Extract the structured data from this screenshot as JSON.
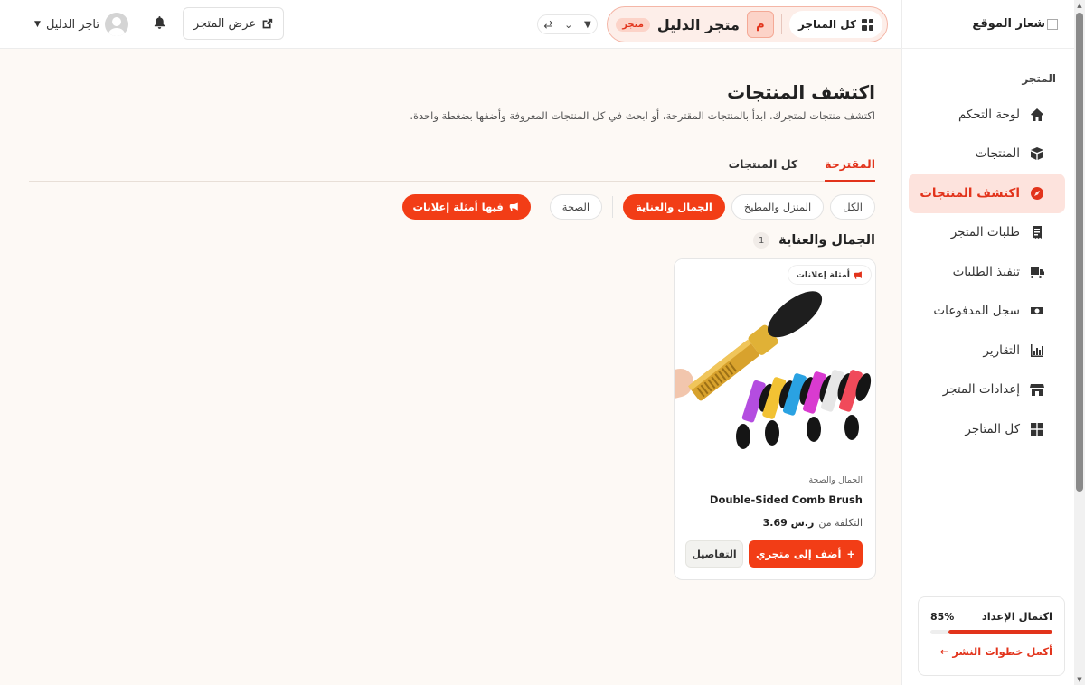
{
  "sidebar": {
    "logo_text": "شعار الموقع",
    "section_title": "المتجر",
    "items": [
      {
        "label": "لوحة التحكم",
        "icon": "home-icon"
      },
      {
        "label": "المنتجات",
        "icon": "box-icon"
      },
      {
        "label": "اكتشف المنتجات",
        "icon": "compass-icon",
        "active": true
      },
      {
        "label": "طلبات المتجر",
        "icon": "receipt-icon"
      },
      {
        "label": "تنفيذ الطلبات",
        "icon": "truck-icon"
      },
      {
        "label": "سجل المدفوعات",
        "icon": "money-icon"
      },
      {
        "label": "التقارير",
        "icon": "chart-icon"
      },
      {
        "label": "إعدادات المتجر",
        "icon": "store-icon"
      },
      {
        "label": "كل المتاجر",
        "icon": "grid-icon"
      }
    ],
    "setup": {
      "title": "اكتمال الإعداد",
      "percent_label": "85%",
      "progress": 0.85,
      "link": "أكمل خطوات النشر ←"
    }
  },
  "topbar": {
    "all_stores": "كل المتاجر",
    "store_initial": "م",
    "store_name": "متجر الدليل",
    "store_badge": "متجر",
    "view_store": "عرض المتجر",
    "user_name": "تاجر الدليل"
  },
  "main": {
    "title": "اكتشف المنتجات",
    "subtitle": "اكتشف منتجات لمتجرك. ابدأ بالمنتجات المقترحة، أو ابحث في كل المنتجات المعروفة وأضفها بضغطة واحدة.",
    "tabs": [
      {
        "label": "المقترحة",
        "active": true
      },
      {
        "label": "كل المنتجات",
        "active": false
      }
    ],
    "chips": [
      {
        "label": "الكل",
        "active": false
      },
      {
        "label": "المنزل والمطبخ",
        "active": false
      },
      {
        "label": "الجمال والعناية",
        "active": true
      },
      {
        "label": "الصحة",
        "active": false
      }
    ],
    "ads_button": "فيها أمثلة إعلانات",
    "category_heading": "الجمال والعناية",
    "category_count": "1",
    "product": {
      "ad_tag": "أمثلة إعلانات",
      "category": "الجمال والصحة",
      "title": "Double-Sided Comb Brush",
      "price_label": "التكلفة من",
      "price_value": "ر.س 3.69",
      "add_button": "أضف إلى متجري",
      "details_button": "التفاصيل"
    }
  },
  "colors": {
    "accent": "#f23d16",
    "accent_soft": "#fde3dd",
    "background": "#fdf9f5"
  }
}
